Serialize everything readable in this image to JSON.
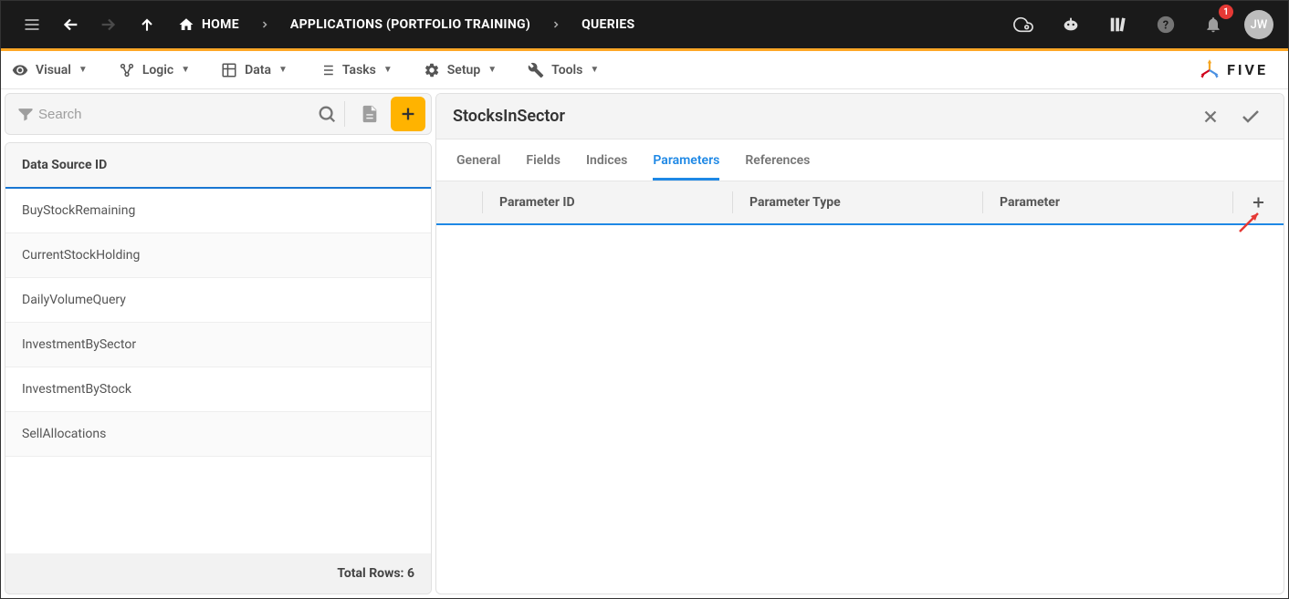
{
  "topbar": {
    "home_label": "HOME",
    "breadcrumb_app": "APPLICATIONS (PORTFOLIO TRAINING)",
    "breadcrumb_page": "QUERIES",
    "notification_count": "1",
    "avatar_initials": "JW"
  },
  "menubar": {
    "items": [
      {
        "label": "Visual"
      },
      {
        "label": "Logic"
      },
      {
        "label": "Data"
      },
      {
        "label": "Tasks"
      },
      {
        "label": "Setup"
      },
      {
        "label": "Tools"
      }
    ],
    "brand": "FIVE"
  },
  "search": {
    "placeholder": "Search"
  },
  "list": {
    "header": "Data Source ID",
    "rows": [
      "BuyStockRemaining",
      "CurrentStockHolding",
      "DailyVolumeQuery",
      "InvestmentBySector",
      "InvestmentByStock",
      "SellAllocations"
    ],
    "footer": "Total Rows: 6"
  },
  "detail": {
    "title": "StocksInSector",
    "tabs": [
      {
        "label": "General",
        "active": false
      },
      {
        "label": "Fields",
        "active": false
      },
      {
        "label": "Indices",
        "active": false
      },
      {
        "label": "Parameters",
        "active": true
      },
      {
        "label": "References",
        "active": false
      }
    ],
    "columns": {
      "a": "Parameter ID",
      "b": "Parameter Type",
      "c": "Parameter"
    }
  }
}
